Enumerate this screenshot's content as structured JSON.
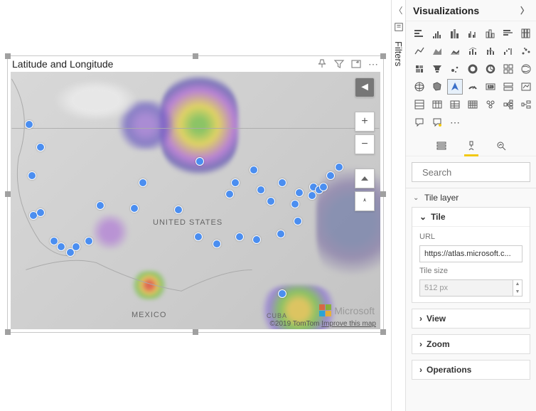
{
  "visual": {
    "title": "Latitude and Longitude",
    "attribution": "©2019 TomTom",
    "improve_link": "Improve this map",
    "brand": "Microsoft",
    "labels": {
      "country1": "UNITED STATES",
      "country2": "MEXICO",
      "country3": "CUBA"
    }
  },
  "panes": {
    "filters_label": "Filters",
    "viz_title": "Visualizations",
    "search_placeholder": "Search"
  },
  "format": {
    "section_tile_layer": "Tile layer",
    "card_tile": "Tile",
    "url_label": "URL",
    "url_value": "https://atlas.microsoft.c...",
    "tilesize_label": "Tile size",
    "tilesize_value": "512 px",
    "card_view": "View",
    "card_zoom": "Zoom",
    "card_operations": "Operations"
  },
  "viz_icons": [
    "stacked-bar",
    "clustered-bar",
    "stacked-column",
    "clustered-column",
    "line",
    "area",
    "stacked-area",
    "line-stacked",
    "ribbon",
    "waterfall",
    "funnel",
    "scatter",
    "pie",
    "donut",
    "treemap",
    "map",
    "filled-map",
    "azure-map",
    "gauge",
    "card",
    "kpi",
    "slicer",
    "table",
    "matrix",
    "r-visual",
    "py-visual",
    "key-influencers",
    "decomp-tree",
    "qna",
    "paginated",
    "more"
  ]
}
